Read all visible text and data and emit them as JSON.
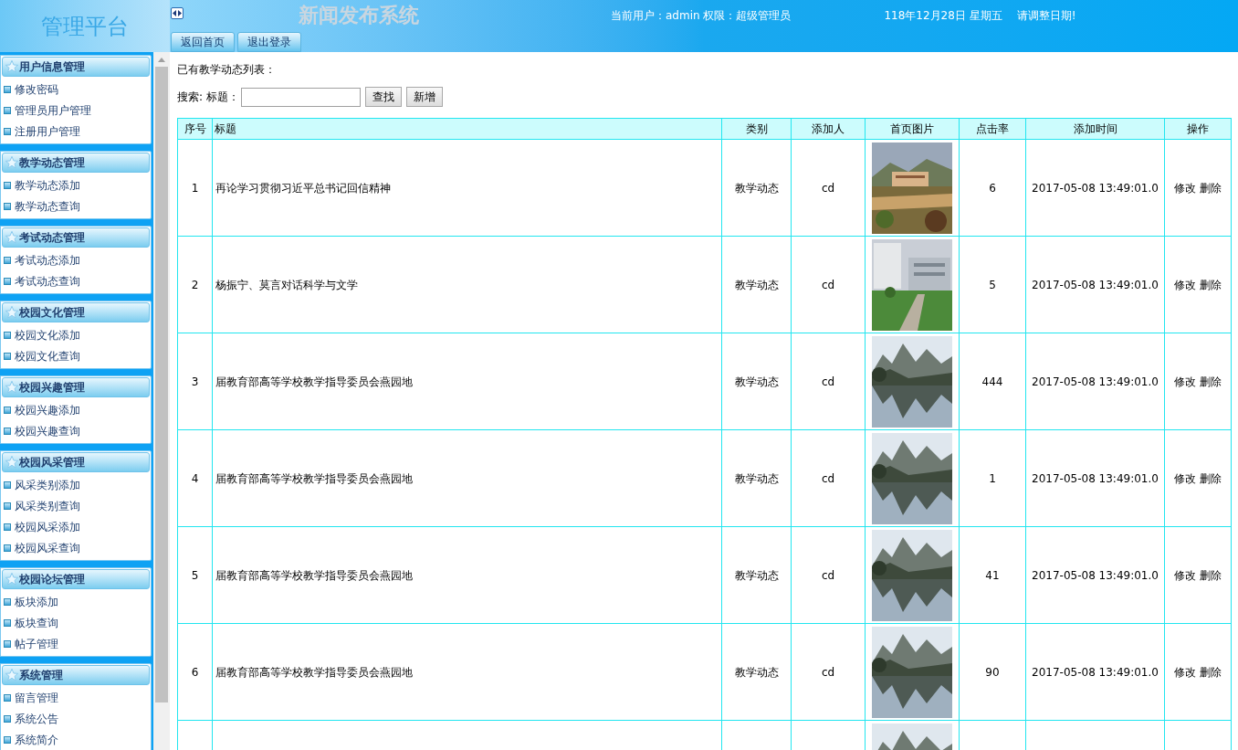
{
  "header": {
    "logo": "管理平台",
    "title": "新闻发布系统",
    "tabs": [
      {
        "label": "返回首页"
      },
      {
        "label": "退出登录"
      }
    ],
    "user_info": "当前用户：admin 权限：超级管理员",
    "date": "118年12月28日 星期五",
    "date_hint": "请调整日期!"
  },
  "sidebar": {
    "groups": [
      {
        "title": "用户信息管理",
        "items": [
          "修改密码",
          "管理员用户管理",
          "注册用户管理"
        ]
      },
      {
        "title": "教学动态管理",
        "items": [
          "教学动态添加",
          "教学动态查询"
        ]
      },
      {
        "title": "考试动态管理",
        "items": [
          "考试动态添加",
          "考试动态查询"
        ]
      },
      {
        "title": "校园文化管理",
        "items": [
          "校园文化添加",
          "校园文化查询"
        ]
      },
      {
        "title": "校园兴趣管理",
        "items": [
          "校园兴趣添加",
          "校园兴趣查询"
        ]
      },
      {
        "title": "校园风采管理",
        "items": [
          "风采类别添加",
          "风采类别查询",
          "校园风采添加",
          "校园风采查询"
        ]
      },
      {
        "title": "校园论坛管理",
        "items": [
          "板块添加",
          "板块查询",
          "帖子管理"
        ]
      },
      {
        "title": "系统管理",
        "items": [
          "留言管理",
          "系统公告",
          "系统简介"
        ]
      }
    ]
  },
  "main": {
    "heading": "已有教学动态列表：",
    "search": {
      "label": "搜索: 标题：",
      "buttons": [
        "查找",
        "新增"
      ]
    },
    "table": {
      "columns": [
        "序号",
        "标题",
        "类别",
        "添加人",
        "首页图片",
        "点击率",
        "添加时间",
        "操作"
      ],
      "rows": [
        {
          "no": "1",
          "title": "再论学习贯彻习近平总书记回信精神",
          "category": "教学动态",
          "author": "cd",
          "image": {
            "kind": "picture"
          },
          "hits": "6",
          "time": "2017-05-08 13:49:01.0",
          "actions": [
            "修改",
            "删除"
          ]
        },
        {
          "no": "2",
          "title": "杨振宁、莫言对话科学与文学",
          "category": "教学动态",
          "author": "cd",
          "image": {
            "kind": "picture"
          },
          "hits": "5",
          "time": "2017-05-08 13:49:01.0",
          "actions": [
            "修改",
            "删除"
          ]
        },
        {
          "no": "3",
          "title": "届教育部高等学校教学指导委员会燕园地",
          "category": "教学动态",
          "author": "cd",
          "image": {
            "kind": "picture"
          },
          "hits": "444",
          "time": "2017-05-08 13:49:01.0",
          "actions": [
            "修改",
            "删除"
          ]
        },
        {
          "no": "4",
          "title": "届教育部高等学校教学指导委员会燕园地",
          "category": "教学动态",
          "author": "cd",
          "image": {
            "kind": "picture"
          },
          "hits": "1",
          "time": "2017-05-08 13:49:01.0",
          "actions": [
            "修改",
            "删除"
          ]
        },
        {
          "no": "5",
          "title": "届教育部高等学校教学指导委员会燕园地",
          "category": "教学动态",
          "author": "cd",
          "image": {
            "kind": "picture"
          },
          "hits": "41",
          "time": "2017-05-08 13:49:01.0",
          "actions": [
            "修改",
            "删除"
          ]
        },
        {
          "no": "6",
          "title": "届教育部高等学校教学指导委员会燕园地",
          "category": "教学动态",
          "author": "cd",
          "image": {
            "kind": "picture"
          },
          "hits": "90",
          "time": "2017-05-08 13:49:01.0",
          "actions": [
            "修改",
            "删除"
          ]
        },
        {
          "image": {
            "kind": "picture"
          }
        }
      ]
    }
  }
}
